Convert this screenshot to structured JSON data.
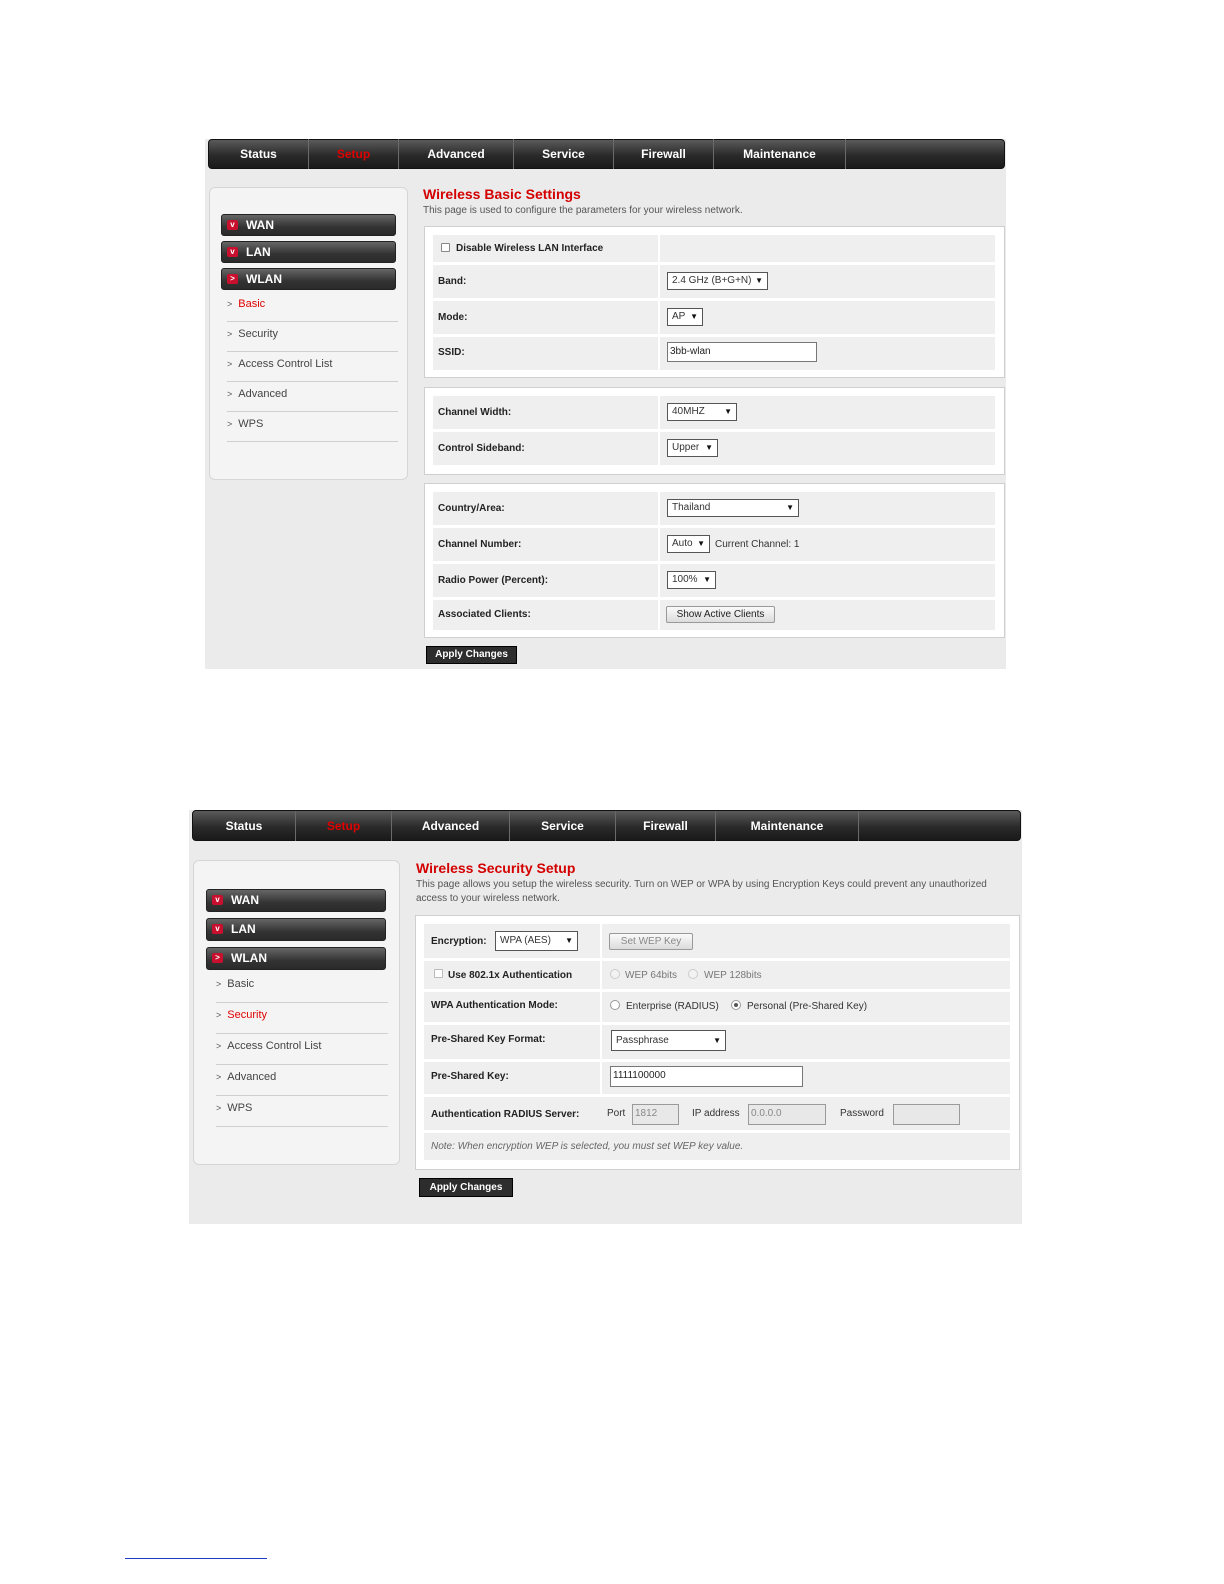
{
  "nav": {
    "items": [
      "Status",
      "Setup",
      "Advanced",
      "Service",
      "Firewall",
      "Maintenance"
    ],
    "active": "Setup"
  },
  "sidebar": {
    "groups": [
      "WAN",
      "LAN",
      "WLAN"
    ],
    "subitems": [
      "Basic",
      "Security",
      "Access Control List",
      "Advanced",
      "WPS"
    ]
  },
  "basic": {
    "title": "Wireless Basic Settings",
    "description": "This page is used to configure the parameters for your wireless network.",
    "disable_label": "Disable Wireless LAN Interface",
    "disable_checked": false,
    "band_label": "Band:",
    "band_value": "2.4 GHz (B+G+N)",
    "mode_label": "Mode:",
    "mode_value": "AP",
    "ssid_label": "SSID:",
    "ssid_value": "3bb-wlan",
    "channel_width_label": "Channel Width:",
    "channel_width_value": "40MHZ",
    "control_sideband_label": "Control Sideband:",
    "control_sideband_value": "Upper",
    "country_label": "Country/Area:",
    "country_value": "Thailand",
    "channel_number_label": "Channel Number:",
    "channel_number_value": "Auto",
    "current_channel_text": "Current Channel: 1",
    "radio_power_label": "Radio Power (Percent):",
    "radio_power_value": "100%",
    "associated_clients_label": "Associated Clients:",
    "show_clients_button": "Show Active Clients",
    "apply_button": "Apply Changes"
  },
  "security": {
    "title": "Wireless Security Setup",
    "description_line1": "This page allows you setup the wireless security. Turn on WEP or WPA by using Encryption Keys could prevent any unauthorized",
    "description_line2": "access to your wireless network.",
    "encryption_label": "Encryption:",
    "encryption_value": "WPA (AES)",
    "set_wep_key_button": "Set WEP Key",
    "use_8021x_label": "Use 802.1x Authentication",
    "wep64_label": "WEP 64bits",
    "wep128_label": "WEP 128bits",
    "wpa_auth_mode_label": "WPA Authentication Mode:",
    "enterprise_label": "Enterprise (RADIUS)",
    "personal_label": "Personal (Pre-Shared Key)",
    "wpa_auth_mode_selected": "Personal (Pre-Shared Key)",
    "psk_format_label": "Pre-Shared Key Format:",
    "psk_format_value": "Passphrase",
    "psk_label": "Pre-Shared Key:",
    "psk_value": "1111100000",
    "radius_label": "Authentication RADIUS Server:",
    "port_label": "Port",
    "port_value": "1812",
    "ip_label": "IP address",
    "ip_value": "0.0.0.0",
    "password_label": "Password",
    "password_value": "",
    "note": "Note: When encryption WEP is selected, you must set WEP key value.",
    "apply_button": "Apply Changes"
  }
}
